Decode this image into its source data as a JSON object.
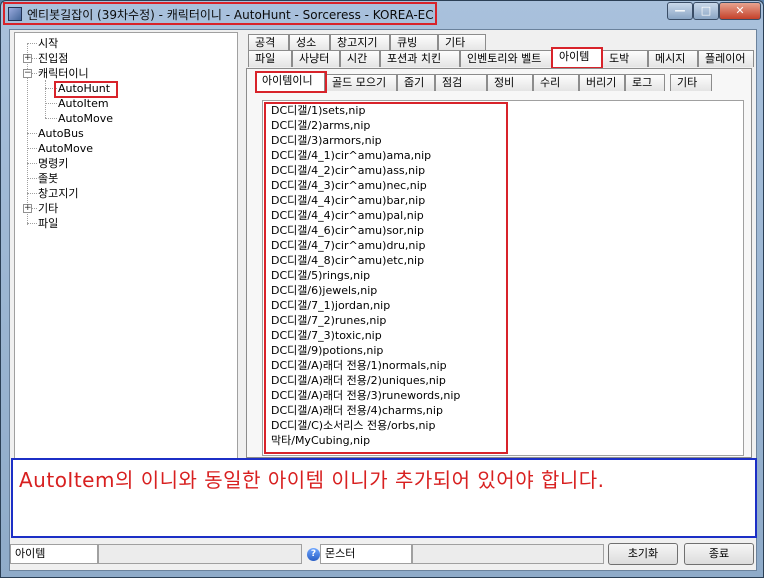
{
  "window": {
    "title": "엔티봇길잡이 (39차수정) - 캐릭터이니 - AutoHunt - Sorceress - KOREA-EC",
    "minimize_glyph": "—",
    "maximize_glyph": "□",
    "close_glyph": "✕"
  },
  "tree": {
    "items": [
      {
        "label": "시작"
      },
      {
        "label": "진입점",
        "expander": "+"
      },
      {
        "label": "캐릭터이니",
        "expander": "−"
      },
      {
        "label": "AutoHunt"
      },
      {
        "label": "AutoItem"
      },
      {
        "label": "AutoMove"
      },
      {
        "label": "AutoBus"
      },
      {
        "label": "AutoMove"
      },
      {
        "label": "명령키"
      },
      {
        "label": "졸봇"
      },
      {
        "label": "창고지기"
      },
      {
        "label": "기타",
        "expander": "+"
      },
      {
        "label": "파일"
      }
    ]
  },
  "tabs": {
    "row1": [
      "공격",
      "성소",
      "창고지기",
      "큐빙",
      "기타"
    ],
    "row2": [
      "파일",
      "사냥터",
      "시간",
      "포션과 치킨",
      "인벤토리와 벨트",
      "아이템",
      "도박",
      "메시지",
      "플레이어"
    ],
    "row3": [
      "아이템이니",
      "골드 모으기",
      "줍기",
      "점검",
      "정비",
      "수리",
      "버리기",
      "로그",
      "기타"
    ]
  },
  "item_list": [
    "DC디갤/1)sets,nip",
    "DC디갤/2)arms,nip",
    "DC디갤/3)armors,nip",
    "DC디갤/4_1)cir^amu)ama,nip",
    "DC디갤/4_2)cir^amu)ass,nip",
    "DC디갤/4_3)cir^amu)nec,nip",
    "DC디갤/4_4)cir^amu)bar,nip",
    "DC디갤/4_4)cir^amu)pal,nip",
    "DC디갤/4_6)cir^amu)sor,nip",
    "DC디갤/4_7)cir^amu)dru,nip",
    "DC디갤/4_8)cir^amu)etc,nip",
    "DC디갤/5)rings,nip",
    "DC디갤/6)jewels,nip",
    "DC디갤/7_1)jordan,nip",
    "DC디갤/7_2)runes,nip",
    "DC디갤/7_3)toxic,nip",
    "DC디갤/9)potions,nip",
    "DC디갤/A)래더 전용/1)normals,nip",
    "DC디갤/A)래더 전용/2)uniques,nip",
    "DC디갤/A)래더 전용/3)runewords,nip",
    "DC디갤/A)래더 전용/4)charms,nip",
    "DC디갤/C)소서리스 전용/orbs,nip",
    "막타/MyCubing,nip"
  ],
  "note": "AutoItem의 이니와 동일한 아이템 이니가 추가되어 있어야 합니다.",
  "statusbar": {
    "left": "아이템",
    "middle": "몬스터",
    "help_glyph": "?",
    "reset_button": "초기화",
    "exit_button": "종료"
  }
}
